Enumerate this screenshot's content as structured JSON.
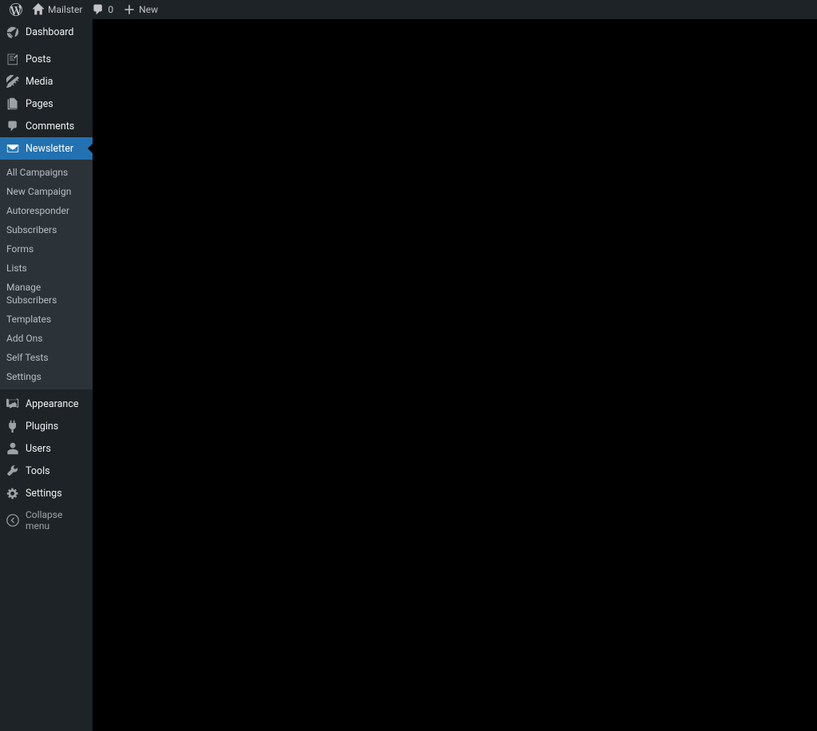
{
  "toolbar": {
    "site_name": "Mailster",
    "comments_count": "0",
    "new_label": "New"
  },
  "sidebar": {
    "dashboard": "Dashboard",
    "posts": "Posts",
    "media": "Media",
    "pages": "Pages",
    "comments": "Comments",
    "newsletter": "Newsletter",
    "newsletter_submenu": {
      "all_campaigns": "All Campaigns",
      "new_campaign": "New Campaign",
      "autoresponder": "Autoresponder",
      "subscribers": "Subscribers",
      "forms": "Forms",
      "lists": "Lists",
      "manage_subscribers": "Manage Subscribers",
      "templates": "Templates",
      "add_ons": "Add Ons",
      "self_tests": "Self Tests",
      "settings": "Settings"
    },
    "appearance": "Appearance",
    "plugins": "Plugins",
    "users": "Users",
    "tools": "Tools",
    "settings": "Settings",
    "collapse": "Collapse menu"
  }
}
